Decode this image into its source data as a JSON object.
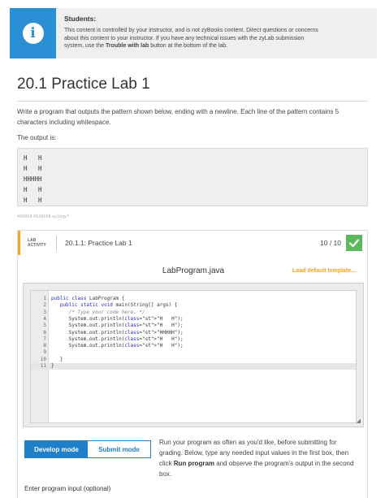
{
  "notice": {
    "title": "Students:",
    "line1": "This content is controlled by your instructor, and is not zyBooks content. Direct questions or concerns",
    "line2": "about this content to your instructor. If you have any technical issues with the zyLab submission",
    "line3_pre": "system, use the ",
    "line3_bold": "Trouble with lab",
    "line3_post": " button at the bottom of the lab.",
    "icon": "info-icon"
  },
  "page": {
    "title": "20.1 Practice Lab 1",
    "description": "Write a program that outputs the pattern shown below, ending with a newline. Each line of the pattern contains 5 characters including whitespace.",
    "output_label": "The output is:",
    "pattern": "H   H\nH   H\nHHHHH\nH   H\nH   H",
    "small_id": "466854.4538668.qx3zqy7"
  },
  "lab": {
    "tag_line1": "LAB",
    "tag_line2": "ACTIVITY",
    "name": "20.1.1: Practice Lab 1",
    "score": "10 / 10",
    "file_name": "LabProgram.java",
    "load_template": "Load default template...",
    "code_lines": [
      {
        "n": "1",
        "text": "public class LabProgram {"
      },
      {
        "n": "2",
        "text": "   public static void main(String[] args) {"
      },
      {
        "n": "3",
        "text": "      /* Type your code here. */"
      },
      {
        "n": "4",
        "text": "      System.out.println(\"H   H\");"
      },
      {
        "n": "5",
        "text": "      System.out.println(\"H   H\");"
      },
      {
        "n": "6",
        "text": "      System.out.println(\"HHHHH\");"
      },
      {
        "n": "7",
        "text": "      System.out.println(\"H   H\");"
      },
      {
        "n": "8",
        "text": "      System.out.println(\"H   H\");"
      },
      {
        "n": "9",
        "text": ""
      },
      {
        "n": "10",
        "text": "   }"
      },
      {
        "n": "11",
        "text": "}"
      }
    ]
  },
  "modes": {
    "develop": "Develop mode",
    "submit": "Submit mode"
  },
  "run_text": {
    "pre": "Run your program as often as you'd like, before submitting for grading. Below, type any needed input values in the first box, then click ",
    "bold": "Run program",
    "post": " and observe the program's output in the second box."
  },
  "input_label": "Enter program input (optional)",
  "colors": {
    "accent": "#2a8fd4",
    "mode_blue": "#1f7fc8",
    "lab_accent": "#f5a623",
    "check_green": "#5cb85c",
    "template_orange": "#f0a020"
  }
}
